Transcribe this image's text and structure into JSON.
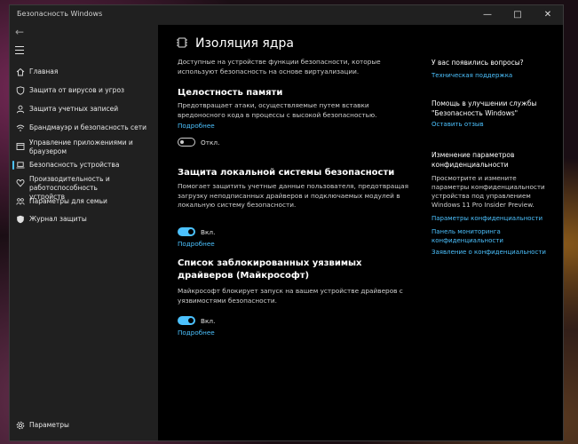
{
  "window": {
    "title": "Безопасность Windows"
  },
  "sidebar": {
    "items": [
      {
        "label": "Главная",
        "icon": "home-icon"
      },
      {
        "label": "Защита от вирусов и угроз",
        "icon": "shield-icon"
      },
      {
        "label": "Защита учетных записей",
        "icon": "person-icon"
      },
      {
        "label": "Брандмауэр и безопасность сети",
        "icon": "wifi-icon"
      },
      {
        "label": "Управление приложениями и браузером",
        "icon": "app-window-icon"
      },
      {
        "label": "Безопасность устройства",
        "icon": "laptop-icon"
      },
      {
        "label": "Производительность и работоспособность устройств",
        "icon": "heart-icon"
      },
      {
        "label": "Параметры для семьи",
        "icon": "family-icon"
      },
      {
        "label": "Журнал защиты",
        "icon": "history-icon"
      }
    ],
    "settings_label": "Параметры"
  },
  "main": {
    "title": "Изоляция ядра",
    "intro": "Доступные на устройстве функции безопасности, которые используют безопасность на основе виртуализации.",
    "sections": [
      {
        "title": "Целостность памяти",
        "description": "Предотвращает атаки, осуществляемые путем вставки вредоносного кода в процессы с высокой безопасностью.",
        "link": "Подробнее",
        "toggle_label": "Откл."
      },
      {
        "title": "Защита локальной системы безопасности",
        "description": "Помогает защитить учетные данные пользователя, предотвращая загрузку неподписанных драйверов и подключаемых модулей в локальную систему безопасности.",
        "toggle_label": "Вкл.",
        "link": "Подробнее"
      },
      {
        "title": "Список заблокированных уязвимых драйверов (Майкрософт)",
        "description": "Майкрософт блокирует запуск на вашем устройстве драйверов с уязвимостями безопасности.",
        "toggle_label": "Вкл.",
        "link": "Подробнее"
      }
    ]
  },
  "right": {
    "questions_title": "У вас появились вопросы?",
    "support_link": "Техническая поддержка",
    "improve_title": "Помощь в улучшении службы \"Безопасность Windows\"",
    "feedback_link": "Оставить отзыв",
    "privacy_title": "Изменение параметров конфиденциальности",
    "privacy_text": "Просмотрите и измените параметры конфиденциальности устройства под управлением Windows 11 Pro Insider Preview.",
    "privacy_link1": "Параметры конфиденциальности",
    "privacy_link2": "Панель мониторинга конфиденциальности",
    "privacy_link3": "Заявление о конфиденциальности"
  },
  "colors": {
    "accent": "#4cc2ff",
    "sidebar_bg": "#202020",
    "main_bg": "#000000"
  }
}
